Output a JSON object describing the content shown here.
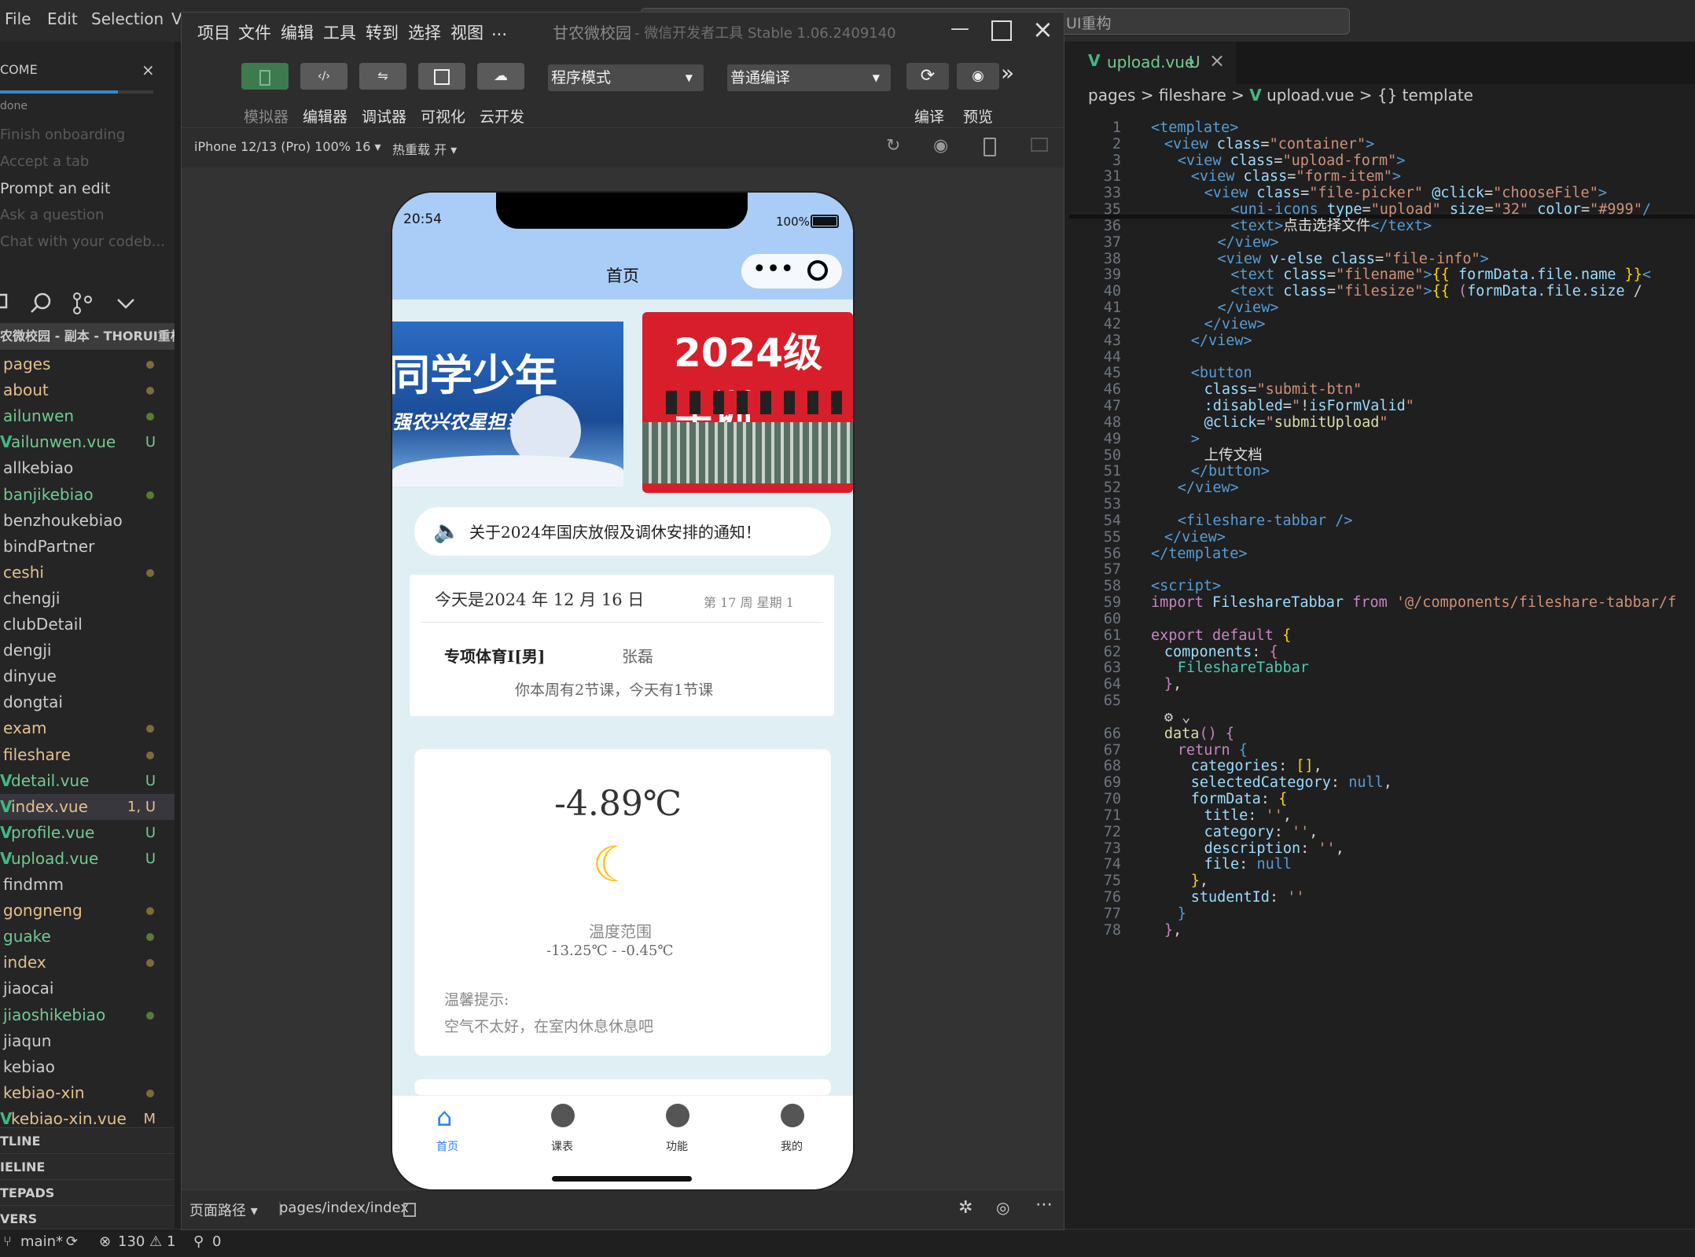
{
  "vscode_menu": {
    "file": "File",
    "edit": "Edit",
    "selection": "Selection",
    "view": "V"
  },
  "search_text": "UI重构",
  "sidebar": {
    "welcome_tab": "COME",
    "status": "done",
    "onboarding": [
      "Finish onboarding",
      "Accept a tab",
      "Prompt an edit",
      "Ask a question",
      "Chat with your codeb..."
    ],
    "project": "农微校园 - 副本 - THORUI重构",
    "tree": [
      {
        "name": "pages",
        "badge": "",
        "color": "#e2c08d",
        "dot": "y"
      },
      {
        "name": "about",
        "badge": "",
        "color": "#e2c08d",
        "dot": "y"
      },
      {
        "name": "ailunwen",
        "badge": "",
        "color": "#73c991",
        "dot": "g"
      },
      {
        "name": "ailunwen.vue",
        "badge": "U",
        "color": "#73c991",
        "dot": ""
      },
      {
        "name": "allkebiao",
        "badge": "",
        "color": "#cccccc",
        "dot": ""
      },
      {
        "name": "banjikebiao",
        "badge": "",
        "color": "#73c991",
        "dot": "g"
      },
      {
        "name": "benzhoukebiao",
        "badge": "",
        "color": "#cccccc",
        "dot": ""
      },
      {
        "name": "bindPartner",
        "badge": "",
        "color": "#cccccc",
        "dot": ""
      },
      {
        "name": "ceshi",
        "badge": "",
        "color": "#e2c08d",
        "dot": "y"
      },
      {
        "name": "chengji",
        "badge": "",
        "color": "#cccccc",
        "dot": ""
      },
      {
        "name": "clubDetail",
        "badge": "",
        "color": "#cccccc",
        "dot": ""
      },
      {
        "name": "dengji",
        "badge": "",
        "color": "#cccccc",
        "dot": ""
      },
      {
        "name": "dinyue",
        "badge": "",
        "color": "#cccccc",
        "dot": ""
      },
      {
        "name": "dongtai",
        "badge": "",
        "color": "#cccccc",
        "dot": ""
      },
      {
        "name": "exam",
        "badge": "",
        "color": "#e2c08d",
        "dot": "y"
      },
      {
        "name": "fileshare",
        "badge": "",
        "color": "#e2c08d",
        "dot": "y"
      },
      {
        "name": "detail.vue",
        "badge": "U",
        "color": "#73c991",
        "dot": ""
      },
      {
        "name": "index.vue",
        "badge": "1, U",
        "color": "#e2c08d",
        "dot": ""
      },
      {
        "name": "profile.vue",
        "badge": "U",
        "color": "#73c991",
        "dot": ""
      },
      {
        "name": "upload.vue",
        "badge": "U",
        "color": "#73c991",
        "dot": ""
      },
      {
        "name": "findmm",
        "badge": "",
        "color": "#cccccc",
        "dot": ""
      },
      {
        "name": "gongneng",
        "badge": "",
        "color": "#e2c08d",
        "dot": "y"
      },
      {
        "name": "guake",
        "badge": "",
        "color": "#73c991",
        "dot": "g"
      },
      {
        "name": "index",
        "badge": "",
        "color": "#e2c08d",
        "dot": "y"
      },
      {
        "name": "jiaocai",
        "badge": "",
        "color": "#cccccc",
        "dot": ""
      },
      {
        "name": "jiaoshikebiao",
        "badge": "",
        "color": "#73c991",
        "dot": "g"
      },
      {
        "name": "jiaqun",
        "badge": "",
        "color": "#cccccc",
        "dot": ""
      },
      {
        "name": "kebiao",
        "badge": "",
        "color": "#cccccc",
        "dot": ""
      },
      {
        "name": "kebiao-xin",
        "badge": "",
        "color": "#e2c08d",
        "dot": "y"
      },
      {
        "name": "kebiao-xin.vue",
        "badge": "M",
        "color": "#e2c08d",
        "dot": ""
      }
    ],
    "sections": [
      "TLINE",
      "IELINE",
      "TEPADS",
      "VERS"
    ]
  },
  "statusbar": {
    "branch": "main*",
    "errors": "130",
    "warnings": "1",
    "ports": "0"
  },
  "devtools": {
    "menu": [
      "项目",
      "文件",
      "编辑",
      "工具",
      "转到",
      "选择",
      "视图",
      "..."
    ],
    "app_title": "甘农微校园",
    "sub_title": "- 微信开发者工具 Stable 1.06.2409140",
    "tools": [
      "模拟器",
      "编辑器",
      "调试器",
      "可视化",
      "云开发"
    ],
    "mode_select": "程序模式",
    "compile_select": "普通编译",
    "compile_label": "编译",
    "preview_label": "预览",
    "device": "iPhone 12/13 (Pro) 100% 16 ▾",
    "hot_reload": "热重载 开 ▾",
    "page_path_label": "页面路径 ▾",
    "page_path": "pages/index/index"
  },
  "phone": {
    "time": "20:54",
    "battery": "100%",
    "nav_title": "首页",
    "banner1_text": "同学少年",
    "banner1_sub": "强农兴农星担当",
    "banner2_text": "2024级军训",
    "notice": "关于2024年国庆放假及调休安排的通知！",
    "today": "今天是2024 年 12 月 16 日",
    "week": "第 17 周 星期 1",
    "course": "专项体育Ⅰ[男]",
    "teacher": "张磊",
    "course_summary": "你本周有2节课，今天有1节课",
    "temperature": "-4.89℃",
    "range_label": "温度范围",
    "range": "-13.25℃ - -0.45℃",
    "tip_label": "温馨提示:",
    "tip": "空气不太好，在室内休息休息吧",
    "tabs": [
      "首页",
      "课表",
      "功能",
      "我的"
    ]
  },
  "editor": {
    "tab": "upload.vue",
    "tab_badge": "U",
    "breadcrumb": [
      "pages",
      ">",
      "fileshare",
      ">",
      "upload.vue",
      ">",
      "{} template"
    ]
  }
}
